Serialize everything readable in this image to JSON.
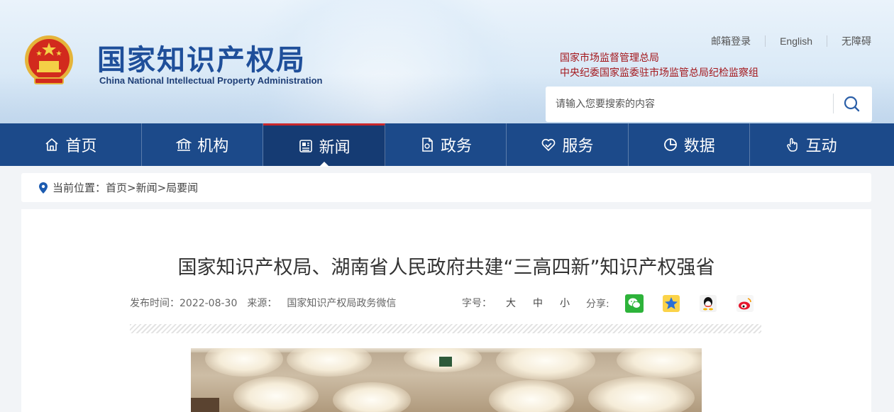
{
  "header": {
    "logo_cn": "国家知识产权局",
    "logo_en": "China National Intellectual Property Administration",
    "top_links": [
      "邮箱登录",
      "English",
      "无障碍"
    ],
    "org_links": [
      "国家市场监督管理总局",
      "中央纪委国家监委驻市场监管总局纪检监察组"
    ],
    "search": {
      "placeholder": "请输入您要搜索的内容",
      "icon": "search-icon"
    }
  },
  "nav": {
    "items": [
      {
        "label": "首页",
        "icon": "home-icon"
      },
      {
        "label": "机构",
        "icon": "institution-icon"
      },
      {
        "label": "新闻",
        "icon": "news-icon",
        "active": true
      },
      {
        "label": "政务",
        "icon": "document-icon"
      },
      {
        "label": "服务",
        "icon": "service-heart-icon"
      },
      {
        "label": "数据",
        "icon": "pie-chart-icon"
      },
      {
        "label": "互动",
        "icon": "hand-pointer-icon"
      }
    ],
    "active_color": "#c9272c",
    "bar_color": "#1c4a8a"
  },
  "breadcrumb": {
    "text": "当前位置：首页>新闻>局要闻",
    "icon": "location-pin-icon"
  },
  "article": {
    "title": "国家知识产权局、湖南省人民政府共建“三高四新”知识产权强省",
    "publish_label": "发布时间：2022-08-30",
    "source_label": "来源：",
    "source_value": "国家知识产权局政务微信",
    "fontsize_label": "字号：",
    "fontsize_options": [
      "大",
      "中",
      "小"
    ],
    "share_label": "分享:",
    "share_icons": [
      "wechat-icon",
      "qzone-icon",
      "qq-icon",
      "weibo-icon"
    ]
  }
}
